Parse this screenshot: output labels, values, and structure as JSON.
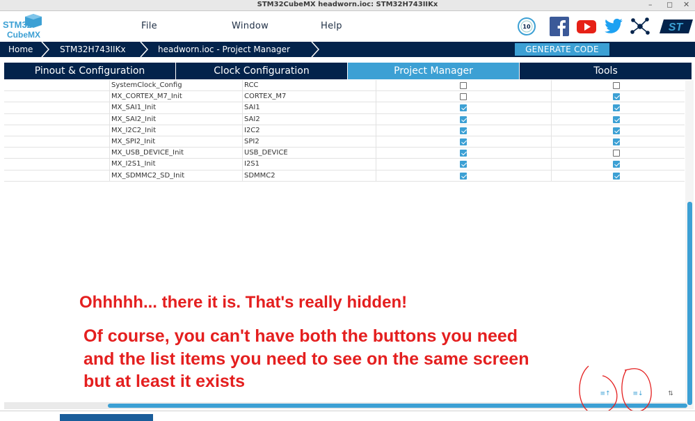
{
  "window": {
    "title": "STM32CubeMX headworn.ioc: STM32H743IIKx"
  },
  "menu": {
    "file": "File",
    "window": "Window",
    "help": "Help"
  },
  "breadcrumb": {
    "home": "Home",
    "device": "STM32H743IIKx",
    "project": "headworn.ioc - Project Manager"
  },
  "actions": {
    "generate": "GENERATE CODE"
  },
  "logo": {
    "line1": "STM32",
    "line2": "CubeMX"
  },
  "badge": {
    "years": "10"
  },
  "tabs": [
    "Pinout & Configuration",
    "Clock Configuration",
    "Project Manager",
    "Tools"
  ],
  "table_rows": [
    {
      "function": "SystemClock_Config",
      "ip": "RCC",
      "generate_call": false,
      "visibility": false
    },
    {
      "function": "MX_CORTEX_M7_Init",
      "ip": "CORTEX_M7",
      "generate_call": false,
      "visibility": true
    },
    {
      "function": "MX_SAI1_Init",
      "ip": "SAI1",
      "generate_call": true,
      "visibility": true
    },
    {
      "function": "MX_SAI2_Init",
      "ip": "SAI2",
      "generate_call": true,
      "visibility": true
    },
    {
      "function": "MX_I2C2_Init",
      "ip": "I2C2",
      "generate_call": true,
      "visibility": true
    },
    {
      "function": "MX_SPI2_Init",
      "ip": "SPI2",
      "generate_call": true,
      "visibility": true
    },
    {
      "function": "MX_USB_DEVICE_Init",
      "ip": "USB_DEVICE",
      "generate_call": true,
      "visibility": false
    },
    {
      "function": "MX_I2S1_Init",
      "ip": "I2S1",
      "generate_call": true,
      "visibility": true
    },
    {
      "function": "MX_SDMMC2_SD_Init",
      "ip": "SDMMC2",
      "generate_call": true,
      "visibility": true
    }
  ],
  "annotations": {
    "line1": "Ohhhhh... there it is.  That's really hidden!",
    "line2": "Of course, you can't have both the buttons you need",
    "line3": "and the list items you need to see on the same screen",
    "line4": "but at least it exists"
  },
  "colors": {
    "navy": "#03234b",
    "accent": "#3ca0d4",
    "annotation": "#e41f1f"
  },
  "icons": [
    "anniversary-badge-icon",
    "facebook-icon",
    "youtube-icon",
    "twitter-icon",
    "network-icon",
    "st-logo-icon",
    "sort-up-icon",
    "sort-down-icon",
    "sort-az-icon"
  ]
}
